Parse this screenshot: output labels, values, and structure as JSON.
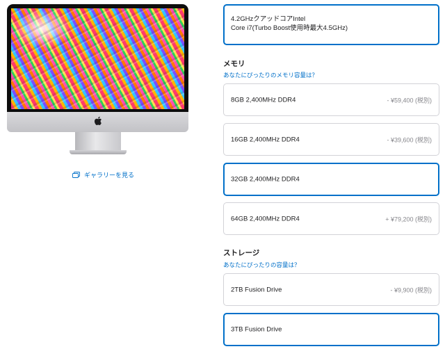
{
  "product": {
    "gallery_link": "ギャラリーを見る",
    "icons": {
      "gallery": "gallery-icon",
      "apple": "apple-logo-icon"
    }
  },
  "processor": {
    "selected_line1": "4.2GHzクアッドコアIntel",
    "selected_line2": "Core i7(Turbo Boost使用時最大4.5GHz)"
  },
  "memory": {
    "title": "メモリ",
    "help": "あなたにぴったりのメモリ容量は？",
    "options": [
      {
        "label": "8GB 2,400MHz DDR4",
        "price": "- ¥59,400 (税別)",
        "selected": false
      },
      {
        "label": "16GB 2,400MHz DDR4",
        "price": "- ¥39,600 (税別)",
        "selected": false
      },
      {
        "label": "32GB 2,400MHz DDR4",
        "price": "",
        "selected": true
      },
      {
        "label": "64GB 2,400MHz DDR4",
        "price": "+ ¥79,200 (税別)",
        "selected": false
      }
    ]
  },
  "storage": {
    "title": "ストレージ",
    "help": "あなたにぴったりの容量は？",
    "options": [
      {
        "label": "2TB Fusion Drive",
        "price": "- ¥9,900 (税別)",
        "selected": false
      },
      {
        "label": "3TB Fusion Drive",
        "price": "",
        "selected": true
      }
    ]
  },
  "colors": {
    "accent": "#0070c9",
    "border": "#d2d2d7",
    "price_gray": "#86868b"
  }
}
